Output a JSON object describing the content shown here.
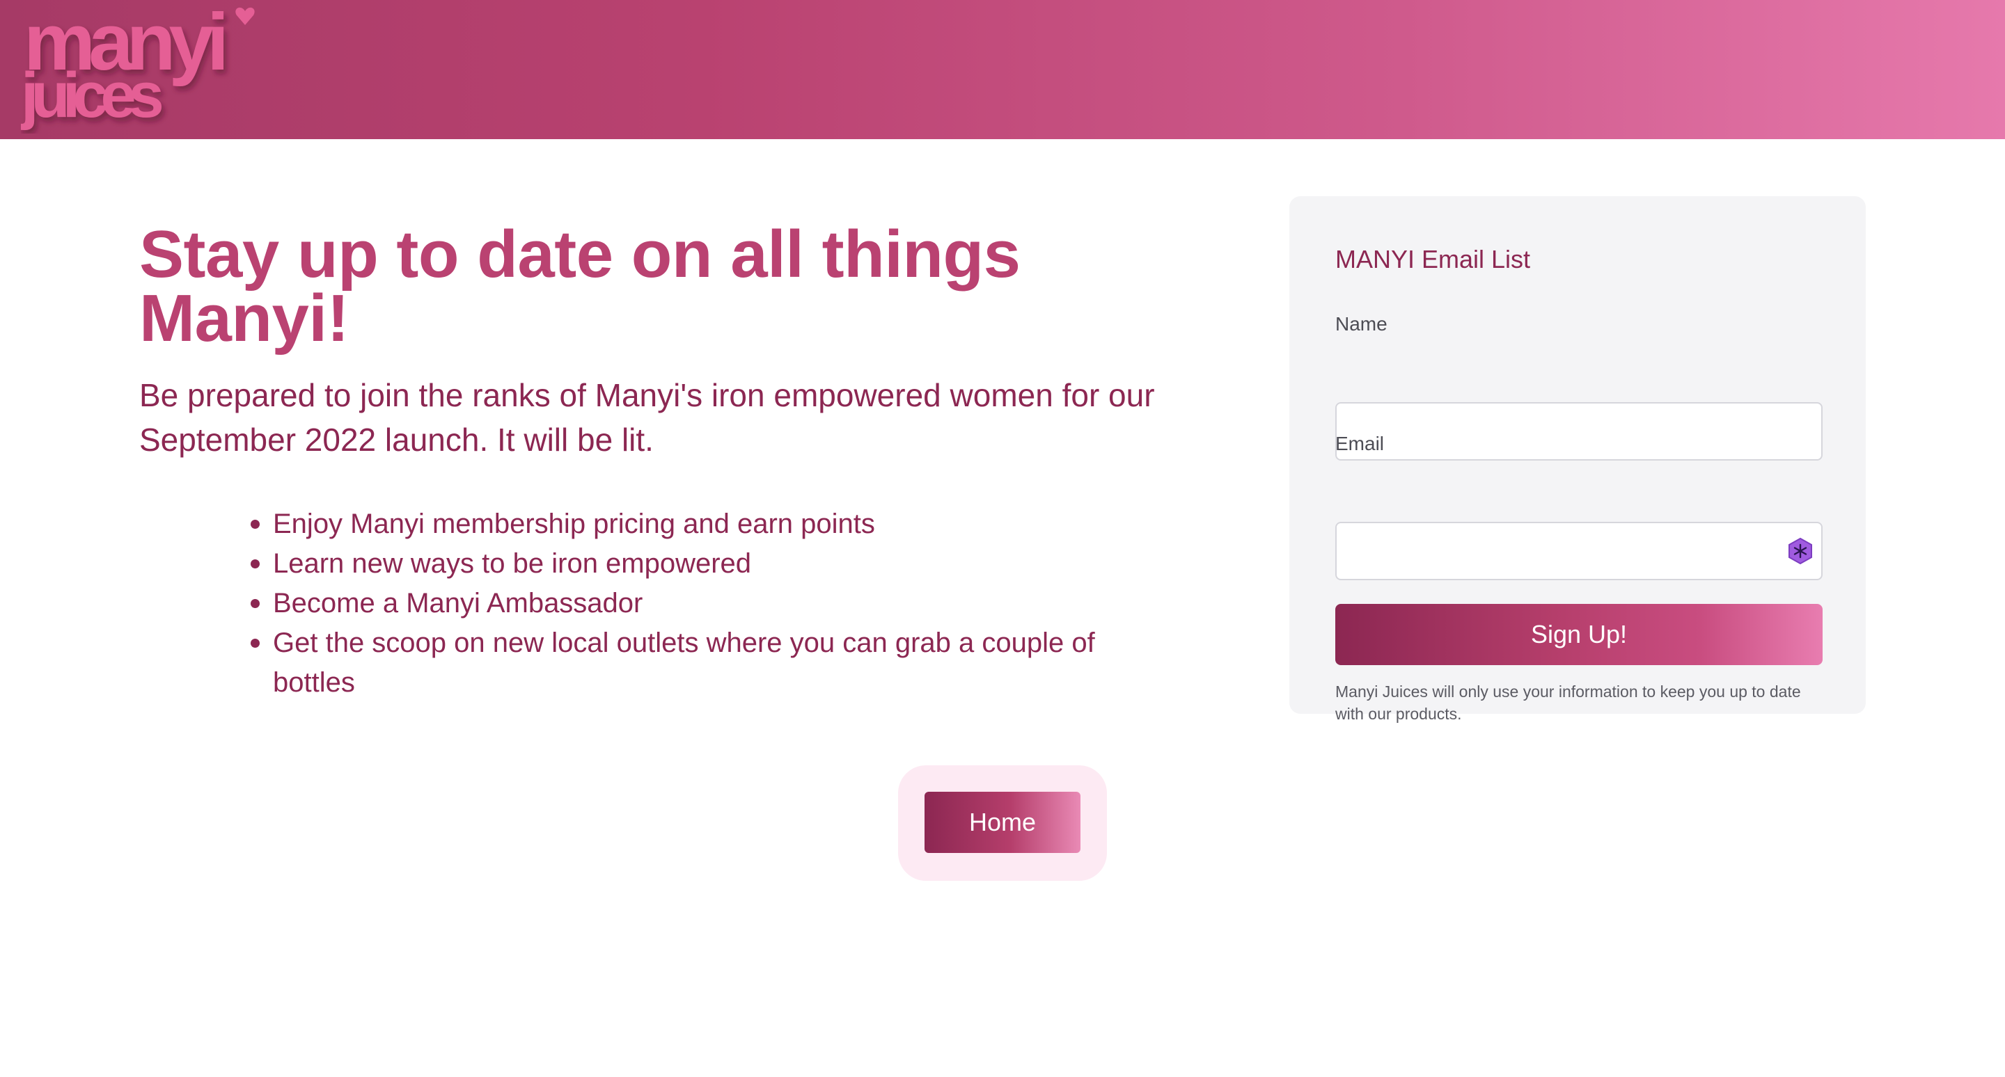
{
  "header": {
    "logo_line1": "manyi",
    "logo_line2": "juices",
    "logo_alt": "manyi juices"
  },
  "hero": {
    "headline_line1": "Stay up to date on all things",
    "headline_line2": "Manyi!",
    "intro": "Be prepared to join the ranks of Manyi's iron empowered women for our September 2022 launch. It will be lit.",
    "bullets": [
      "Enjoy Manyi membership pricing and earn points",
      "Learn new ways to be iron empowered",
      "Become a Manyi Ambassador",
      "Get the scoop on new local outlets where you can grab a couple of bottles"
    ]
  },
  "form": {
    "title": "MANYI Email List",
    "name_label": "Name",
    "name_value": "",
    "email_label": "Email",
    "email_value": "",
    "submit_label": "Sign Up!",
    "disclaimer": "Manyi Juices will only use your information to keep you up to date with our products."
  },
  "nav": {
    "home_label": "Home"
  },
  "colors": {
    "brand_primary": "#ba4271",
    "brand_dark": "#8c2752",
    "brand_light": "#e679ac",
    "card_bg": "#f4f4f6"
  }
}
